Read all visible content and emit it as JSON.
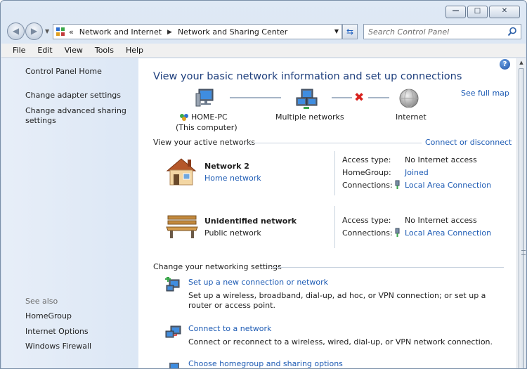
{
  "window": {
    "minimize_glyph": "—",
    "maximize_glyph": "□",
    "close_glyph": "✕"
  },
  "nav": {
    "back_icon": "back-arrow-icon",
    "forward_icon": "forward-arrow-icon",
    "breadcrumb_prefix": "«",
    "breadcrumb_separator": "▶",
    "breadcrumbs": [
      "Network and Internet",
      "Network and Sharing Center"
    ],
    "search_placeholder": "Search Control Panel"
  },
  "menu": [
    "File",
    "Edit",
    "View",
    "Tools",
    "Help"
  ],
  "sidebar": {
    "home": "Control Panel Home",
    "tasks": [
      "Change adapter settings",
      "Change advanced sharing settings"
    ],
    "see_also_label": "See also",
    "see_also": [
      "HomeGroup",
      "Internet Options",
      "Windows Firewall"
    ]
  },
  "main": {
    "title": "View your basic network information and set up connections",
    "see_full_map": "See full map",
    "map": {
      "computer_name": "HOME-PC",
      "computer_caption": "(This computer)",
      "middle": "Multiple networks",
      "internet": "Internet"
    },
    "active_networks_label": "View your active networks",
    "connect_or_disconnect": "Connect or disconnect",
    "networks": [
      {
        "name": "Network  2",
        "category": "Home network",
        "access_type_label": "Access type:",
        "access_type": "No Internet access",
        "homegroup_label": "HomeGroup:",
        "homegroup": "Joined",
        "connections_label": "Connections:",
        "connection": "Local Area Connection"
      },
      {
        "name": "Unidentified network",
        "category": "Public network",
        "access_type_label": "Access type:",
        "access_type": "No Internet access",
        "connections_label": "Connections:",
        "connection": "Local Area Connection"
      }
    ],
    "change_settings_label": "Change your networking settings",
    "tasks": [
      {
        "title": "Set up a new connection or network",
        "desc": "Set up a wireless, broadband, dial-up, ad hoc, or VPN connection; or set up a router or access point."
      },
      {
        "title": "Connect to a network",
        "desc": "Connect or reconnect to a wireless, wired, dial-up, or VPN network connection."
      },
      {
        "title": "Choose homegroup and sharing options",
        "desc": ""
      }
    ]
  },
  "colors": {
    "heading": "#1e3f7d",
    "link": "#1d5bb4",
    "error": "#d8231f",
    "sidebar_bg": "#dce7f5"
  }
}
